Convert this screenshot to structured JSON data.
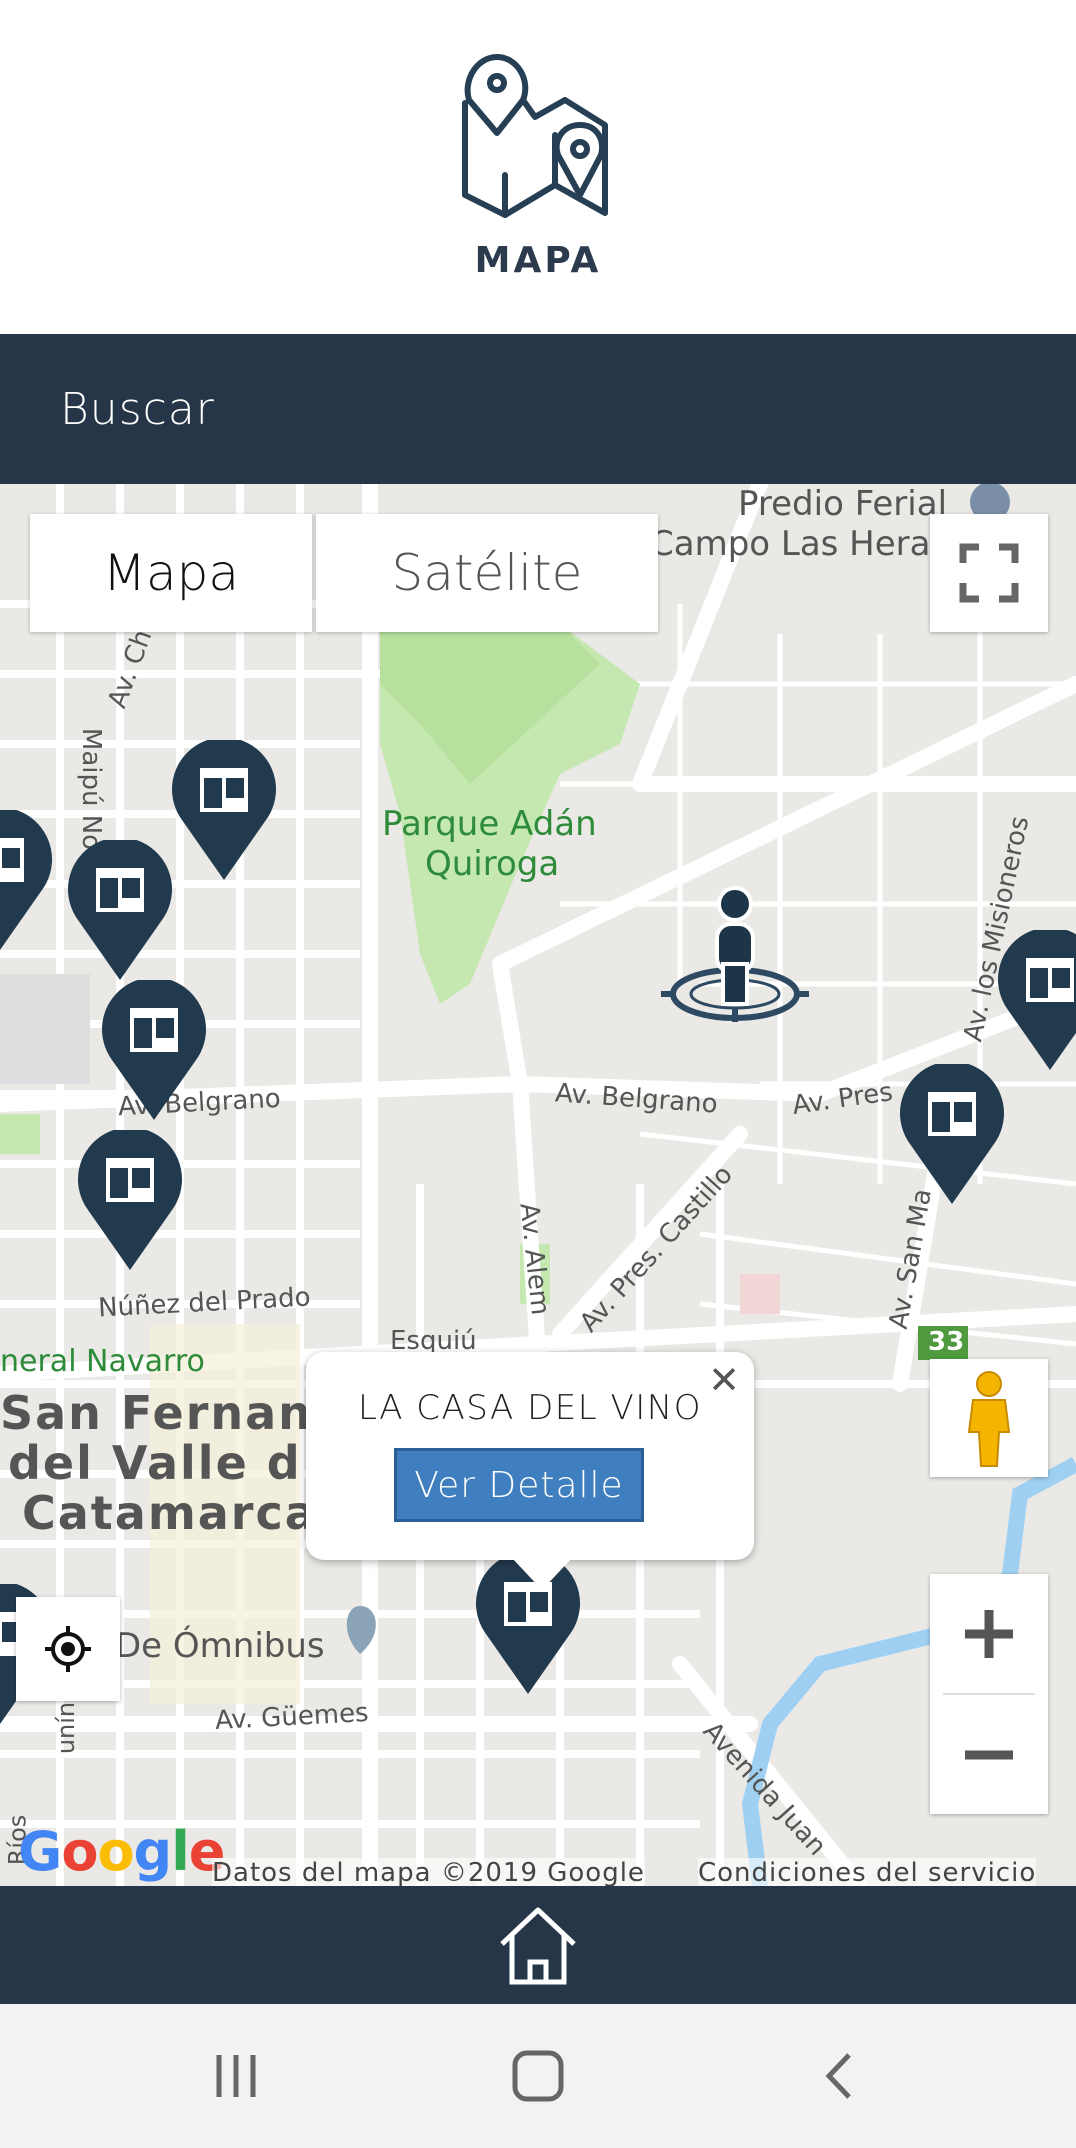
{
  "header": {
    "title": "MAPA",
    "logo_icon": "map-pin-icon"
  },
  "search": {
    "label": "Buscar"
  },
  "map": {
    "type_control": {
      "map_label": "Mapa",
      "satellite_label": "Satélite"
    },
    "labels": {
      "predio_ferial": "Predio Ferial",
      "campo_las_heras": "Campo Las Heras",
      "parque_line1": "Parque Adán",
      "parque_line2": "Quiroga",
      "av_belgrano_left": "Av. Belgrano",
      "av_belgrano_center": "Av. Belgrano",
      "av_pres": "Av. Pres",
      "av_los_misioneros": "Av. los Misioneros",
      "av_pres_castillo": "Av. Pres. Castillo",
      "av_alem": "Av. Alem",
      "av_san_ma": "Av. San Ma",
      "nunez_del_prado": "Núñez del Prado",
      "esquiu": "Esquiú",
      "general_navarro": "neral Navarro",
      "city_line1": "San Fernanc",
      "city_line2": "del Valle d",
      "city_line3": "Catamarca",
      "omnibus": "De Ómnibus",
      "av_guemes": "Av. Güemes",
      "avenida_juan": "Avenida Juan",
      "mapu_no": "Maipú No",
      "av_ch": "Av. Ch",
      "union": "unín",
      "rios": "Ríos",
      "route_badge": "33"
    },
    "attribution": {
      "google": "Google",
      "data": "Datos del mapa ©2019 Google",
      "terms": "Condiciones del servicio"
    },
    "popup": {
      "title": "LA CASA DEL VINO",
      "button_label": "Ver Detalle"
    },
    "colors": {
      "marker": "#223a4e",
      "park": "#c5e8b0",
      "water": "#9fd0f2",
      "road": "#ffffff",
      "navy": "#263547",
      "button": "#3f7fc0"
    }
  },
  "bottom_nav": {
    "home_icon": "home-icon"
  },
  "system_nav": {
    "recent_icon": "recent-apps-icon",
    "home_icon": "system-home-icon",
    "back_icon": "back-icon"
  }
}
